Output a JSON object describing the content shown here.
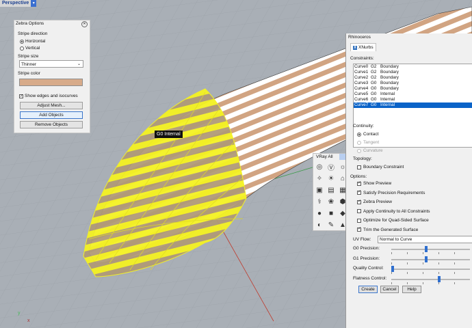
{
  "viewport": {
    "label": "Perspective",
    "tag_text": "G0 Internal",
    "axis_y": "y",
    "axis_x": "x",
    "colors": {
      "background": "#a9afb6",
      "grid": "#9aa0a7",
      "stripe_light": "#ffffff",
      "stripe_dark": "#d1a482",
      "highlight": "#f4f222"
    }
  },
  "zebra": {
    "title": "Zebra Options",
    "direction_label": "Stripe direction",
    "direction_options": [
      "Horizontal",
      "Vertical"
    ],
    "direction_selected": "Horizontal",
    "size_label": "Stripe size",
    "size_value": "Thinner",
    "color_label": "Stripe color",
    "color_value": "#d7ab8a",
    "show_edges_label": "Show edges and isocurves",
    "show_edges_checked": true,
    "buttons": {
      "adjust": "Adjust Mesh...",
      "add": "Add Objects",
      "remove": "Remove Objects"
    }
  },
  "vray": {
    "title": "VRay All",
    "icons": [
      "render-icon",
      "vray-logo-icon",
      "rhino-icon",
      "light-bulb-icon",
      "sun-icon",
      "dome-light-icon",
      "render-region-icon",
      "frame-buffer-icon",
      "assets-icon",
      "lamp-icon",
      "fur-icon",
      "proxy-icon",
      "sphere-icon",
      "cube-icon",
      "decal-icon",
      "material-ball-icon",
      "brush-icon",
      "displacement-icon"
    ]
  },
  "rhino": {
    "window_title": "Rhinoceros",
    "tab": "XNurbs",
    "constraints_label": "Constraints:",
    "constraints": [
      {
        "curve": "Curve0",
        "g": "G2",
        "type": "Boundary",
        "selected": false
      },
      {
        "curve": "Curve1",
        "g": "G2",
        "type": "Boundary",
        "selected": false
      },
      {
        "curve": "Curve2",
        "g": "G2",
        "type": "Boundary",
        "selected": false
      },
      {
        "curve": "Curve3",
        "g": "G0",
        "type": "Boundary",
        "selected": false
      },
      {
        "curve": "Curve4",
        "g": "G0",
        "type": "Boundary",
        "selected": false
      },
      {
        "curve": "Curve5",
        "g": "G0",
        "type": "Internal",
        "selected": false
      },
      {
        "curve": "Curve6",
        "g": "G0",
        "type": "Internal",
        "selected": false
      },
      {
        "curve": "Curve7",
        "g": "G0",
        "type": "Internal",
        "selected": true
      }
    ],
    "continuity_label": "Continuity:",
    "continuity_options": [
      {
        "label": "Contact",
        "enabled": true,
        "selected": true
      },
      {
        "label": "Tangent",
        "enabled": false,
        "selected": false
      },
      {
        "label": "Curvature",
        "enabled": false,
        "selected": false
      }
    ],
    "topology_label": "Topology:",
    "boundary_constraint": {
      "label": "Boundary Constraint",
      "checked": false
    },
    "options_label": "Options:",
    "options": [
      {
        "label": "Show Preview",
        "checked": true
      },
      {
        "label": "Satisfy Precision Requirements",
        "checked": true
      },
      {
        "label": "Zebra Preview",
        "checked": true
      },
      {
        "label": "Apply Continuity to All Constraints",
        "checked": false
      },
      {
        "label": "Optimize for Quad-Sided Surface",
        "checked": false
      },
      {
        "label": "Trim the Generated Surface",
        "checked": true
      }
    ],
    "uv_flow_label": "UV Flow:",
    "uv_flow_value": "Normal to Curve",
    "sliders": [
      {
        "label": "G0 Precision:",
        "value_fraction": 0.44
      },
      {
        "label": "G1 Precision:",
        "value_fraction": 0.44
      },
      {
        "label": "Quality Control:",
        "value_fraction": 0.02
      },
      {
        "label": "Flatness Control:",
        "value_fraction": 0.61
      }
    ],
    "buttons": {
      "create": "Create",
      "cancel": "Cancel",
      "help": "Help"
    }
  }
}
